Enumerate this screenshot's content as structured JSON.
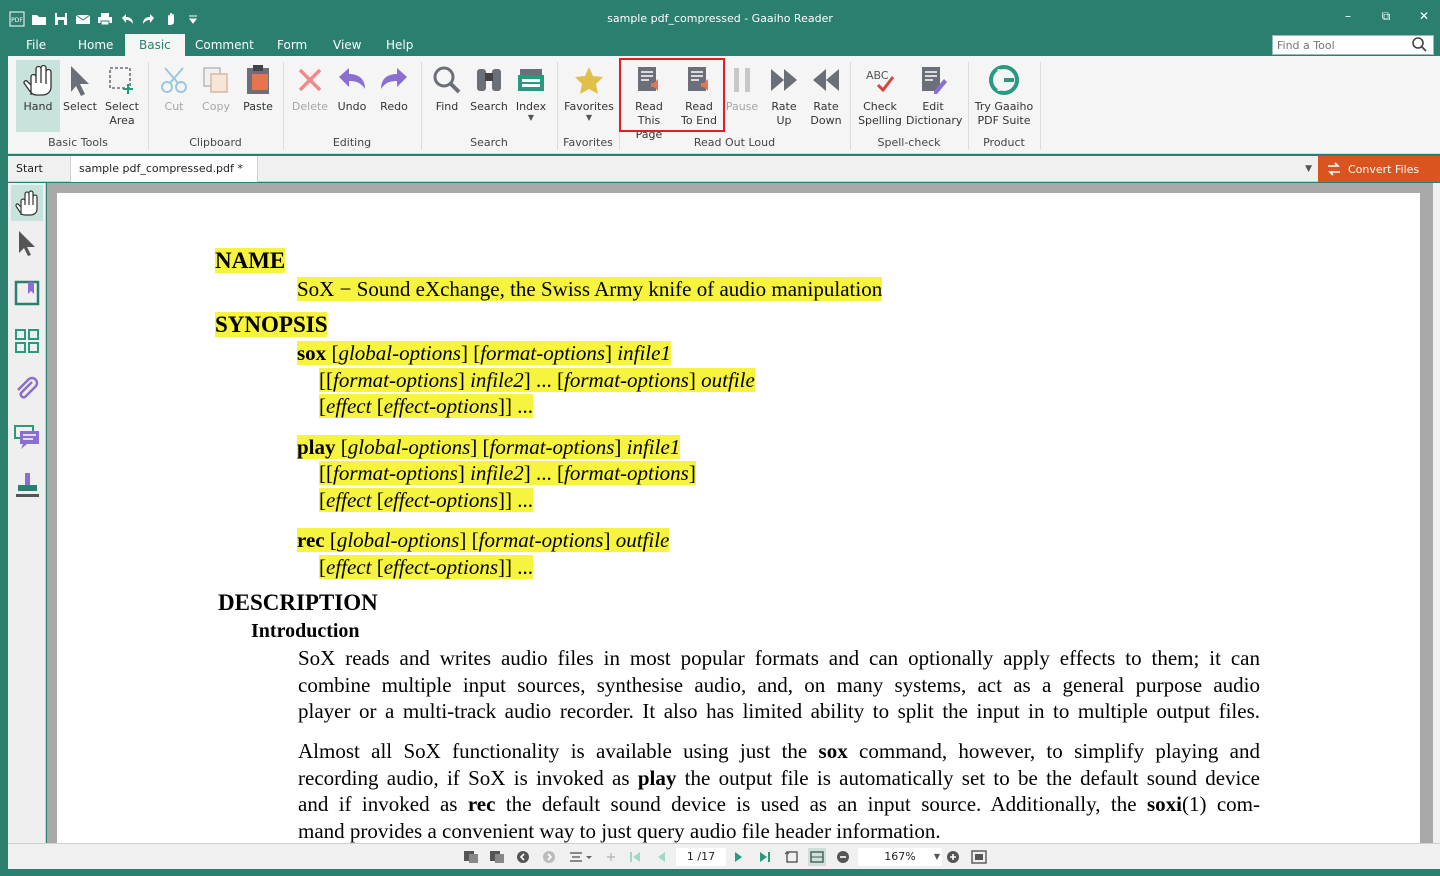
{
  "app": {
    "title": "sample pdf_compressed - Gaaiho Reader"
  },
  "menu_tabs": [
    "File",
    "Home",
    "Basic",
    "Comment",
    "Form",
    "View",
    "Help"
  ],
  "active_tab": "Basic",
  "find_tool": {
    "placeholder": "Find a Tool"
  },
  "ribbon": {
    "hand": "Hand",
    "select": "Select",
    "select_area_1": "Select",
    "select_area_2": "Area",
    "cut": "Cut",
    "copy": "Copy",
    "paste": "Paste",
    "delete": "Delete",
    "undo": "Undo",
    "redo": "Redo",
    "find": "Find",
    "search": "Search",
    "index": "Index",
    "favorites": "Favorites",
    "read_page_1": "Read",
    "read_page_2": "This Page",
    "read_end_1": "Read",
    "read_end_2": "To End",
    "pause": "Pause",
    "rate_up_1": "Rate",
    "rate_up_2": "Up",
    "rate_down_1": "Rate",
    "rate_down_2": "Down",
    "check_1": "Check",
    "check_2": "Spelling",
    "edit_dict_1": "Edit",
    "edit_dict_2": "Dictionary",
    "try_1": "Try Gaaiho",
    "try_2": "PDF Suite",
    "groups": {
      "basic_tools": "Basic Tools",
      "clipboard": "Clipboard",
      "editing": "Editing",
      "search": "Search",
      "favorites": "Favorites",
      "read_out_loud": "Read Out Loud",
      "spell_check": "Spell-check",
      "product": "Product"
    }
  },
  "doc_tabs": {
    "start": "Start",
    "file": "sample pdf_compressed.pdf *",
    "convert": "Convert Files"
  },
  "document": {
    "name_heading": "NAME",
    "name_text": "SoX − Sound eXchange, the Swiss Army knife of audio manipulation",
    "synopsis_heading": "SYNOPSIS",
    "sox_cmd": "sox",
    "play_cmd": "play",
    "rec_cmd": "rec",
    "opt_global": "global-options",
    "opt_format": "format-options",
    "infile1": "infile1",
    "infile2": "infile2",
    "outfile": "outfile",
    "effect": "effect",
    "effect_options": "effect-options",
    "description_heading": "DESCRIPTION",
    "intro_heading": "Introduction",
    "p1_l1": "SoX reads and writes audio files in most popular formats and can optionally apply effects to them; it can",
    "p1_l2": "combine multiple input sources, synthesise audio, and, on many systems, act as a general purpose audio",
    "p1_l3": "player or a multi-track audio recorder. It also has limited ability to split the input in to multiple output files.",
    "p2_l1a": "Almost all SoX functionality is available using just the ",
    "p2_l1b": "sox",
    "p2_l1c": " command, however, to simplify playing and",
    "p2_l2a": "recording audio, if SoX is invoked as ",
    "p2_l2b": "play",
    "p2_l2c": " the output file is automatically set to be the default sound device",
    "p2_l3a": "and if invoked as ",
    "p2_l3b": "rec",
    "p2_l3c": " the default sound device is used as an input source.  Additionally, the ",
    "p2_l3d": "soxi",
    "p2_l3e": "(1) com-",
    "p2_l4": "mand provides a convenient way to just query audio file header information."
  },
  "nav": {
    "page": "1 /17",
    "zoom": "167%"
  },
  "colors": {
    "accent": "#2a7f6f",
    "highlight": "#f6f43f",
    "convert": "#d9541e"
  }
}
